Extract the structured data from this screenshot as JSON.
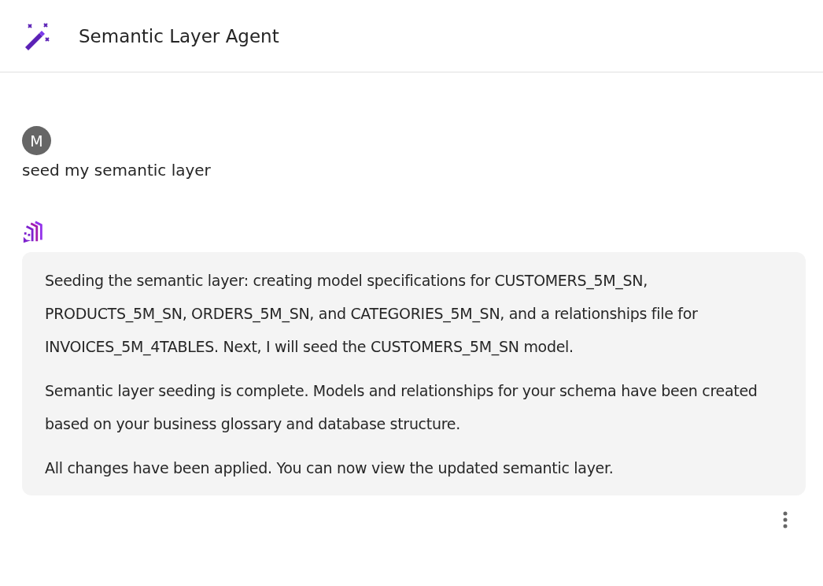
{
  "header": {
    "title": "Semantic Layer Agent"
  },
  "messages": [
    {
      "kind": "user",
      "avatar": "M",
      "paragraphs": [
        "seed my semantic layer"
      ]
    },
    {
      "kind": "agent",
      "paragraphs": [
        "Seeding the semantic layer: creating model specifications for CUSTOMERS_5M_SN, PRODUCTS_5M_SN, ORDERS_5M_SN, and CATEGORIES_5M_SN, and a relationships file for INVOICES_5M_4TABLES. Next, I will seed the CUSTOMERS_5M_SN model.",
        "Semantic layer seeding is complete. Models and relationships for your schema have been created based on your business glossary and database structure.",
        "All changes have been applied. You can now view the updated semantic layer."
      ]
    }
  ]
}
